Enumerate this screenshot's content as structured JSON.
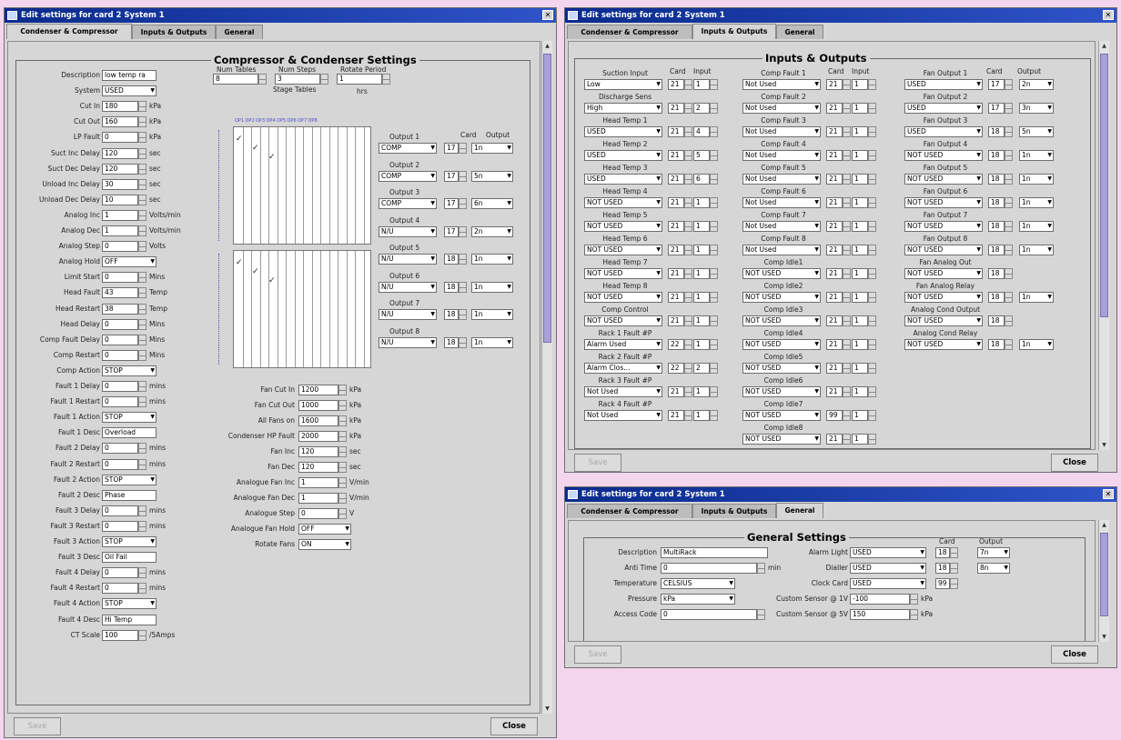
{
  "win1": {
    "title": "Edit settings for card 2 System 1",
    "tabs": [
      "Condenser & Compressor",
      "Inputs & Outputs",
      "General"
    ],
    "group_title": "Compressor & Condenser Settings",
    "left_fields": [
      {
        "label": "Description",
        "value": "low temp ra",
        "kind": "text"
      },
      {
        "label": "System",
        "value": "USED",
        "kind": "combo"
      },
      {
        "label": "Cut In",
        "value": "180",
        "kind": "spin",
        "unit": "kPa"
      },
      {
        "label": "Cut Out",
        "value": "160",
        "kind": "spin",
        "unit": "kPa"
      },
      {
        "label": "LP Fault",
        "value": "0",
        "kind": "spin",
        "unit": "kPa"
      },
      {
        "label": "Suct Inc Delay",
        "value": "120",
        "kind": "spin",
        "unit": "sec"
      },
      {
        "label": "Suct Dec Delay",
        "value": "120",
        "kind": "spin",
        "unit": "sec"
      },
      {
        "label": "Unload Inc Delay",
        "value": "30",
        "kind": "spin",
        "unit": "sec"
      },
      {
        "label": "Unload Dec Delay",
        "value": "10",
        "kind": "spin",
        "unit": "sec"
      },
      {
        "label": "Analog Inc",
        "value": "1",
        "kind": "spin",
        "unit": "Volts/min"
      },
      {
        "label": "Analog Dec",
        "value": "1",
        "kind": "spin",
        "unit": "Volts/min"
      },
      {
        "label": "Analog Step",
        "value": "0",
        "kind": "spin",
        "unit": "Volts"
      },
      {
        "label": "Analog Hold",
        "value": "OFF",
        "kind": "combo"
      },
      {
        "label": "Limit Start",
        "value": "0",
        "kind": "spin",
        "unit": "Mins"
      },
      {
        "label": "Head Fault",
        "value": "43",
        "kind": "spin",
        "unit": "Temp"
      },
      {
        "label": "Head Restart",
        "value": "38",
        "kind": "spin",
        "unit": "Temp"
      },
      {
        "label": "Head Delay",
        "value": "0",
        "kind": "spin",
        "unit": "Mins"
      },
      {
        "label": "Comp Fault Delay",
        "value": "0",
        "kind": "spin",
        "unit": "Mins"
      },
      {
        "label": "Comp Restart",
        "value": "0",
        "kind": "spin",
        "unit": "Mins"
      },
      {
        "label": "Comp Action",
        "value": "STOP",
        "kind": "combo"
      },
      {
        "label": "Fault 1 Delay",
        "value": "0",
        "kind": "spin",
        "unit": "mins"
      },
      {
        "label": "Fault 1 Restart",
        "value": "0",
        "kind": "spin",
        "unit": "mins"
      },
      {
        "label": "Fault 1 Action",
        "value": "STOP",
        "kind": "combo"
      },
      {
        "label": "Fault 1 Desc",
        "value": "Overload",
        "kind": "text"
      },
      {
        "label": "Fault 2 Delay",
        "value": "0",
        "kind": "spin",
        "unit": "mins"
      },
      {
        "label": "Fault 2 Restart",
        "value": "0",
        "kind": "spin",
        "unit": "mins"
      },
      {
        "label": "Fault 2 Action",
        "value": "STOP",
        "kind": "combo"
      },
      {
        "label": "Fault 2 Desc",
        "value": "Phase",
        "kind": "text"
      },
      {
        "label": "Fault 3 Delay",
        "value": "0",
        "kind": "spin",
        "unit": "mins"
      },
      {
        "label": "Fault 3 Restart",
        "value": "0",
        "kind": "spin",
        "unit": "mins"
      },
      {
        "label": "Fault 3 Action",
        "value": "STOP",
        "kind": "combo"
      },
      {
        "label": "Fault 3 Desc",
        "value": "Oil Fail",
        "kind": "text"
      },
      {
        "label": "Fault 4 Delay",
        "value": "0",
        "kind": "spin",
        "unit": "mins"
      },
      {
        "label": "Fault 4 Restart",
        "value": "0",
        "kind": "spin",
        "unit": "mins"
      },
      {
        "label": "Fault 4 Action",
        "value": "STOP",
        "kind": "combo"
      },
      {
        "label": "Fault 4 Desc",
        "value": "Hi Temp",
        "kind": "text"
      },
      {
        "label": "CT Scale",
        "value": "100",
        "kind": "spin",
        "unit": "/5Amps"
      }
    ],
    "top_params": [
      {
        "label": "Num Tables",
        "value": "8"
      },
      {
        "label": "Num Steps",
        "value": "3"
      },
      {
        "label": "Rotate Period",
        "value": "1",
        "unit": "hrs"
      }
    ],
    "stage_label": "Stage Tables",
    "stage_cols": [
      "OP1",
      "OP2",
      "OP3",
      "OP4",
      "OP5",
      "OP6",
      "OP7",
      "OP8"
    ],
    "outputs_headers": {
      "card": "Card",
      "output": "Output"
    },
    "outputs": [
      {
        "label": "Output 1",
        "type": "COMP",
        "card": "17",
        "out": "1n"
      },
      {
        "label": "Output 2",
        "type": "COMP",
        "card": "17",
        "out": "5n"
      },
      {
        "label": "Output 3",
        "type": "COMP",
        "card": "17",
        "out": "6n"
      },
      {
        "label": "Output 4",
        "type": "N/U",
        "card": "17",
        "out": "2n"
      },
      {
        "label": "Output 5",
        "type": "N/U",
        "card": "18",
        "out": "1n"
      },
      {
        "label": "Output 6",
        "type": "N/U",
        "card": "18",
        "out": "1n"
      },
      {
        "label": "Output 7",
        "type": "N/U",
        "card": "18",
        "out": "1n"
      },
      {
        "label": "Output 8",
        "type": "N/U",
        "card": "18",
        "out": "1n"
      }
    ],
    "fan_fields": [
      {
        "label": "Fan Cut In",
        "value": "1200",
        "unit": "kPa"
      },
      {
        "label": "Fan Cut Out",
        "value": "1000",
        "unit": "kPa"
      },
      {
        "label": "All Fans on",
        "value": "1600",
        "unit": "kPa"
      },
      {
        "label": "Condenser HP Fault",
        "value": "2000",
        "unit": "kPa"
      },
      {
        "label": "Fan Inc",
        "value": "120",
        "unit": "sec"
      },
      {
        "label": "Fan Dec",
        "value": "120",
        "unit": "sec"
      },
      {
        "label": "Analogue Fan Inc",
        "value": "1",
        "unit": "V/min"
      },
      {
        "label": "Analogue Fan Dec",
        "value": "1",
        "unit": "V/min"
      },
      {
        "label": "Analogue Step",
        "value": "0",
        "unit": "V"
      },
      {
        "label": "Analogue Fan Hold",
        "value": "OFF",
        "combo": true
      },
      {
        "label": "Rotate Fans",
        "value": "ON",
        "combo": true
      }
    ],
    "save": "Save",
    "close": "Close"
  },
  "win2": {
    "title": "Edit settings for card 2 System 1",
    "tabs": [
      "Condenser & Compressor",
      "Inputs & Outputs",
      "General"
    ],
    "group_title": "Inputs & Outputs",
    "h_card": "Card",
    "h_input": "Input",
    "h_output": "Output",
    "col1": [
      {
        "label": "Suction Input",
        "value": "Low",
        "card": "21",
        "io": "1"
      },
      {
        "label": "Discharge Sens",
        "value": "High",
        "card": "21",
        "io": "2"
      },
      {
        "label": "Head Temp 1",
        "value": "USED",
        "card": "21",
        "io": "4"
      },
      {
        "label": "Head Temp 2",
        "value": "USED",
        "card": "21",
        "io": "5"
      },
      {
        "label": "Head Temp 3",
        "value": "USED",
        "card": "21",
        "io": "6"
      },
      {
        "label": "Head Temp 4",
        "value": "NOT USED",
        "card": "21",
        "io": "1"
      },
      {
        "label": "Head Temp 5",
        "value": "NOT USED",
        "card": "21",
        "io": "1"
      },
      {
        "label": "Head Temp 6",
        "value": "NOT USED",
        "card": "21",
        "io": "1"
      },
      {
        "label": "Head Temp 7",
        "value": "NOT USED",
        "card": "21",
        "io": "1"
      },
      {
        "label": "Head Temp 8",
        "value": "NOT USED",
        "card": "21",
        "io": "1"
      },
      {
        "label": "Comp Control",
        "value": "NOT USED",
        "card": "21",
        "io": "1"
      },
      {
        "label": "Rack 1 Fault #P",
        "value": "Alarm Used",
        "card": "22",
        "io": "1"
      },
      {
        "label": "Rack 2 Fault #P",
        "value": "Alarm Clos...",
        "card": "22",
        "io": "2"
      },
      {
        "label": "Rack 3 Fault #P",
        "value": "Not Used",
        "card": "21",
        "io": "1"
      },
      {
        "label": "Rack 4 Fault #P",
        "value": "Not Used",
        "card": "21",
        "io": "1"
      }
    ],
    "col2": [
      {
        "label": "Comp Fault 1",
        "value": "Not Used",
        "card": "21",
        "io": "1"
      },
      {
        "label": "Comp Fault 2",
        "value": "Not Used",
        "card": "21",
        "io": "1"
      },
      {
        "label": "Comp Fault 3",
        "value": "Not Used",
        "card": "21",
        "io": "1"
      },
      {
        "label": "Comp Fault 4",
        "value": "Not Used",
        "card": "21",
        "io": "1"
      },
      {
        "label": "Comp Fault 5",
        "value": "Not Used",
        "card": "21",
        "io": "1"
      },
      {
        "label": "Comp Fault 6",
        "value": "Not Used",
        "card": "21",
        "io": "1"
      },
      {
        "label": "Comp Fault 7",
        "value": "Not Used",
        "card": "21",
        "io": "1"
      },
      {
        "label": "Comp Fault 8",
        "value": "Not Used",
        "card": "21",
        "io": "1"
      },
      {
        "label": "Comp Idle1",
        "value": "NOT USED",
        "card": "21",
        "io": "1"
      },
      {
        "label": "Comp Idle2",
        "value": "NOT USED",
        "card": "21",
        "io": "1"
      },
      {
        "label": "Comp Idle3",
        "value": "NOT USED",
        "card": "21",
        "io": "1"
      },
      {
        "label": "Comp Idle4",
        "value": "NOT USED",
        "card": "21",
        "io": "1"
      },
      {
        "label": "Comp Idle5",
        "value": "NOT USED",
        "card": "21",
        "io": "1"
      },
      {
        "label": "Comp Idle6",
        "value": "NOT USED",
        "card": "21",
        "io": "1"
      },
      {
        "label": "Comp Idle7",
        "value": "NOT USED",
        "card": "99",
        "io": "1"
      },
      {
        "label": "Comp Idle8",
        "value": "NOT USED",
        "card": "21",
        "io": "1"
      }
    ],
    "col3": [
      {
        "label": "Fan Output 1",
        "value": "USED",
        "card": "17",
        "io": "2n",
        "pair": true
      },
      {
        "label": "Fan Output 2",
        "value": "USED",
        "card": "17",
        "io": "3n",
        "pair": true
      },
      {
        "label": "Fan Output 3",
        "value": "USED",
        "card": "18",
        "io": "5n",
        "pair": true
      },
      {
        "label": "Fan Output 4",
        "value": "NOT USED",
        "card": "18",
        "io": "1n",
        "pair": true
      },
      {
        "label": "Fan Output 5",
        "value": "NOT USED",
        "card": "18",
        "io": "1n",
        "pair": true
      },
      {
        "label": "Fan Output 6",
        "value": "NOT USED",
        "card": "18",
        "io": "1n",
        "pair": true
      },
      {
        "label": "Fan Output 7",
        "value": "NOT USED",
        "card": "18",
        "io": "1n",
        "pair": true
      },
      {
        "label": "Fan Output 8",
        "value": "NOT USED",
        "card": "18",
        "io": "1n",
        "pair": true
      },
      {
        "label": "Fan Analog Out",
        "value": "NOT USED",
        "card": "18",
        "io": "",
        "pair": false
      },
      {
        "label": "Fan Analog Relay",
        "value": "NOT USED",
        "card": "18",
        "io": "1n",
        "pair": true
      },
      {
        "label": "Analog Cond Output",
        "value": "NOT USED",
        "card": "18",
        "io": "",
        "pair": false
      },
      {
        "label": "Analog Cond Relay",
        "value": "NOT USED",
        "card": "18",
        "io": "1n",
        "pair": true
      }
    ],
    "save": "Save",
    "close": "Close"
  },
  "win3": {
    "title": "Edit settings for card 2 System 1",
    "tabs": [
      "Condenser & Compressor",
      "Inputs & Outputs",
      "General"
    ],
    "group_title": "General Settings",
    "h_card": "Card",
    "h_output": "Output",
    "left": [
      {
        "label": "Description",
        "value": "MultiRack",
        "kind": "text"
      },
      {
        "label": "Anti Time",
        "value": "0",
        "kind": "spin",
        "unit": "min"
      },
      {
        "label": "Temperature",
        "value": "CELSIUS",
        "kind": "combo"
      },
      {
        "label": "Pressure",
        "value": "kPa",
        "kind": "combo"
      },
      {
        "label": "Access Code",
        "value": "0",
        "kind": "spin"
      }
    ],
    "right": [
      {
        "label": "Alarm Light",
        "value": "USED",
        "card": "18",
        "out": "7n"
      },
      {
        "label": "Dialler",
        "value": "USED",
        "card": "18",
        "out": "8n"
      },
      {
        "label": "Clock Card",
        "value": "USED",
        "card": "99"
      },
      {
        "label": "Custom Sensor @ 1V",
        "value": "-100",
        "unit": "kPa"
      },
      {
        "label": "Custom Sensor @ 5V",
        "value": "150",
        "unit": "kPa"
      }
    ],
    "save": "Save",
    "close": "Close"
  }
}
